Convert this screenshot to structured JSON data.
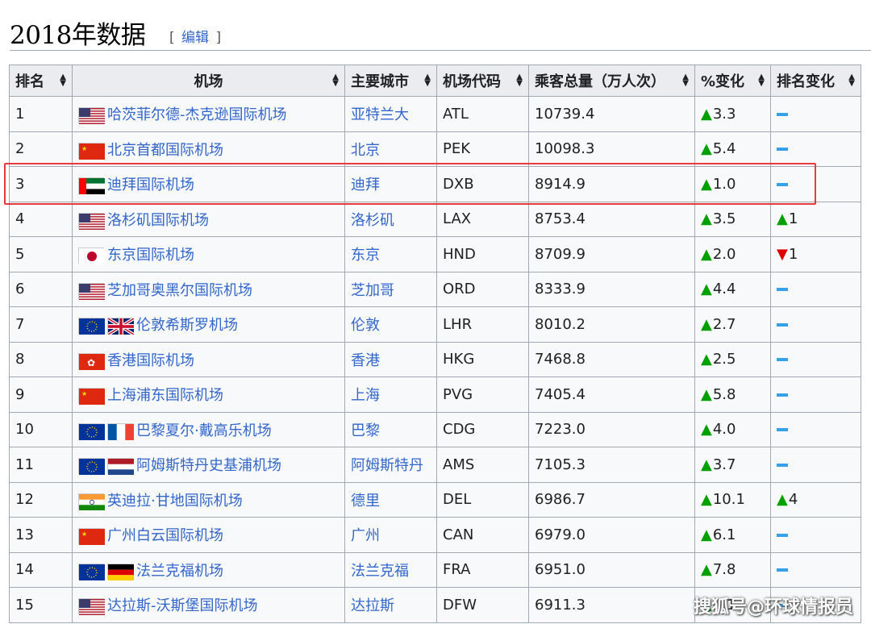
{
  "heading": {
    "title": "2018年数据",
    "edit_open": "[",
    "edit_label": "编辑",
    "edit_close": "]"
  },
  "table": {
    "headers": [
      "排名",
      "机场",
      "主要城市",
      "机场代码",
      "乘客总量（万人次）",
      "%变化",
      "排名变化"
    ],
    "rows": [
      {
        "rank": "1",
        "flags": [
          "us"
        ],
        "airport": "哈茨菲尔德-杰克逊国际机场",
        "city": "亚特兰大",
        "code": "ATL",
        "passengers": "10739.4",
        "change_dir": "up",
        "change": "3.3",
        "rank_change_dir": "same",
        "rank_change": ""
      },
      {
        "rank": "2",
        "flags": [
          "cn"
        ],
        "airport": "北京首都国际机场",
        "city": "北京",
        "code": "PEK",
        "passengers": "10098.3",
        "change_dir": "up",
        "change": "5.4",
        "rank_change_dir": "same",
        "rank_change": ""
      },
      {
        "rank": "3",
        "flags": [
          "ae"
        ],
        "airport": "迪拜国际机场",
        "city": "迪拜",
        "code": "DXB",
        "passengers": "8914.9",
        "change_dir": "up",
        "change": "1.0",
        "rank_change_dir": "same",
        "rank_change": ""
      },
      {
        "rank": "4",
        "flags": [
          "us"
        ],
        "airport": "洛杉矶国际机场",
        "city": "洛杉矶",
        "code": "LAX",
        "passengers": "8753.4",
        "change_dir": "up",
        "change": "3.5",
        "rank_change_dir": "up",
        "rank_change": "1"
      },
      {
        "rank": "5",
        "flags": [
          "jp"
        ],
        "airport": "东京国际机场",
        "city": "东京",
        "code": "HND",
        "passengers": "8709.9",
        "change_dir": "up",
        "change": "2.0",
        "rank_change_dir": "down",
        "rank_change": "1"
      },
      {
        "rank": "6",
        "flags": [
          "us"
        ],
        "airport": "芝加哥奥黑尔国际机场",
        "city": "芝加哥",
        "code": "ORD",
        "passengers": "8333.9",
        "change_dir": "up",
        "change": "4.4",
        "rank_change_dir": "same",
        "rank_change": ""
      },
      {
        "rank": "7",
        "flags": [
          "eu",
          "uk"
        ],
        "airport": "伦敦希斯罗机场",
        "city": "伦敦",
        "code": "LHR",
        "passengers": "8010.2",
        "change_dir": "up",
        "change": "2.7",
        "rank_change_dir": "same",
        "rank_change": ""
      },
      {
        "rank": "8",
        "flags": [
          "hk"
        ],
        "airport": "香港国际机场",
        "city": "香港",
        "code": "HKG",
        "passengers": "7468.8",
        "change_dir": "up",
        "change": "2.5",
        "rank_change_dir": "same",
        "rank_change": ""
      },
      {
        "rank": "9",
        "flags": [
          "cn"
        ],
        "airport": "上海浦东国际机场",
        "city": "上海",
        "code": "PVG",
        "passengers": "7405.4",
        "change_dir": "up",
        "change": "5.8",
        "rank_change_dir": "same",
        "rank_change": ""
      },
      {
        "rank": "10",
        "flags": [
          "eu",
          "fr"
        ],
        "airport": "巴黎夏尔·戴高乐机场",
        "city": "巴黎",
        "code": "CDG",
        "passengers": "7223.0",
        "change_dir": "up",
        "change": "4.0",
        "rank_change_dir": "same",
        "rank_change": ""
      },
      {
        "rank": "11",
        "flags": [
          "eu",
          "nl"
        ],
        "airport": "阿姆斯特丹史基浦机场",
        "city": "阿姆斯特丹",
        "code": "AMS",
        "passengers": "7105.3",
        "change_dir": "up",
        "change": "3.7",
        "rank_change_dir": "same",
        "rank_change": ""
      },
      {
        "rank": "12",
        "flags": [
          "in"
        ],
        "airport": "英迪拉·甘地国际机场",
        "city": "德里",
        "code": "DEL",
        "passengers": "6986.7",
        "change_dir": "up",
        "change": "10.1",
        "rank_change_dir": "up",
        "rank_change": "4"
      },
      {
        "rank": "13",
        "flags": [
          "cn"
        ],
        "airport": "广州白云国际机场",
        "city": "广州",
        "code": "CAN",
        "passengers": "6979.0",
        "change_dir": "up",
        "change": "6.1",
        "rank_change_dir": "same",
        "rank_change": ""
      },
      {
        "rank": "14",
        "flags": [
          "eu",
          "de"
        ],
        "airport": "法兰克福机场",
        "city": "法兰克福",
        "code": "FRA",
        "passengers": "6951.0",
        "change_dir": "up",
        "change": "7.8",
        "rank_change_dir": "same",
        "rank_change": ""
      },
      {
        "rank": "15",
        "flags": [
          "us"
        ],
        "airport": "达拉斯-沃斯堡国际机场",
        "city": "达拉斯",
        "code": "DFW",
        "passengers": "6911.3",
        "change_dir": "up",
        "change": "0.1",
        "rank_change_dir": "same",
        "rank_change": ""
      }
    ]
  },
  "symbols": {
    "up": "▲",
    "down": "▼",
    "sort": "⇕"
  },
  "colors": {
    "link": "#3366cc",
    "up": "#00a000",
    "down": "#dd0000",
    "same": "#36a0e8",
    "highlight": "#e83a3a"
  },
  "watermark": "搜狐号@环球情报员"
}
